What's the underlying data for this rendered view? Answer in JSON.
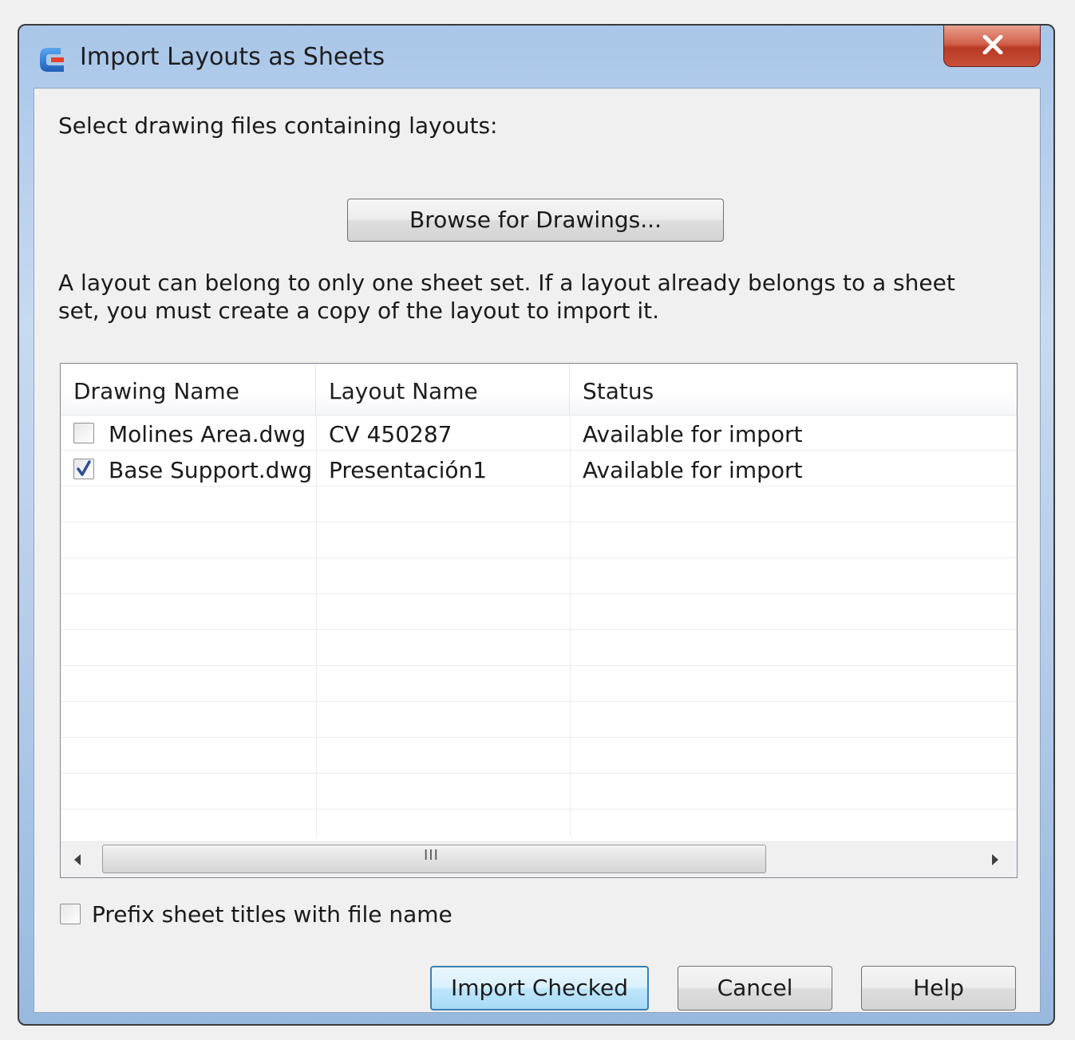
{
  "window": {
    "title": "Import Layouts as Sheets",
    "close_label": "X"
  },
  "dialog": {
    "instruction": "Select drawing files containing layouts:",
    "browse_label": "Browse for Drawings...",
    "info_text": "A layout can belong to only one sheet set. If a layout already belongs to a sheet set, you must create a copy of the layout to import it."
  },
  "table": {
    "columns": [
      "Drawing Name",
      "Layout Name",
      "Status"
    ],
    "rows": [
      {
        "checked": false,
        "drawing": "Molines Area.dwg",
        "layout": "CV 450287",
        "status": "Available for import"
      },
      {
        "checked": true,
        "drawing": "Base Support.dwg",
        "layout": "Presentación1",
        "status": "Available for import"
      }
    ],
    "scroll_grip": "III"
  },
  "options": {
    "prefix_label": "Prefix sheet titles with file name",
    "prefix_checked": false
  },
  "buttons": {
    "import_label": "Import Checked",
    "cancel_label": "Cancel",
    "help_label": "Help"
  },
  "colors": {
    "title_gradient": "#b6cde9",
    "close_red": "#c8513a",
    "default_button_border": "#3c7fb1"
  }
}
